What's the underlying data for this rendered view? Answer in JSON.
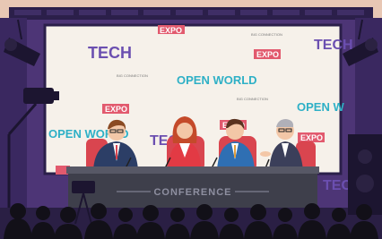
{
  "backdrop": {
    "tech": "TECH",
    "open_world": "OPEN WORLD",
    "open_world_cut": "OPEN W",
    "expo": "EXPO",
    "small_caption": "BIG CONNECTION"
  },
  "table": {
    "banner": "CONFERENCE"
  },
  "colors": {
    "stage_purple": "#5a3f86",
    "truss_dark": "#2b1f4a",
    "backdrop": "#f6f1ea",
    "tech_purple": "#6b4fb0",
    "open_world_teal": "#2eb0c6",
    "expo_red": "#e25a6e",
    "table": "#3e3f4b",
    "banner_text": "#8e8fa0",
    "audience": "#121018"
  },
  "panelists": [
    {
      "role": "speaker-left",
      "suit": "#2c3e66"
    },
    {
      "role": "speaker-center",
      "dress": "#e23a44"
    },
    {
      "role": "speaker-right",
      "suit": "#2f6fb3"
    },
    {
      "role": "moderator",
      "suit": "#3b3f5a"
    }
  ]
}
